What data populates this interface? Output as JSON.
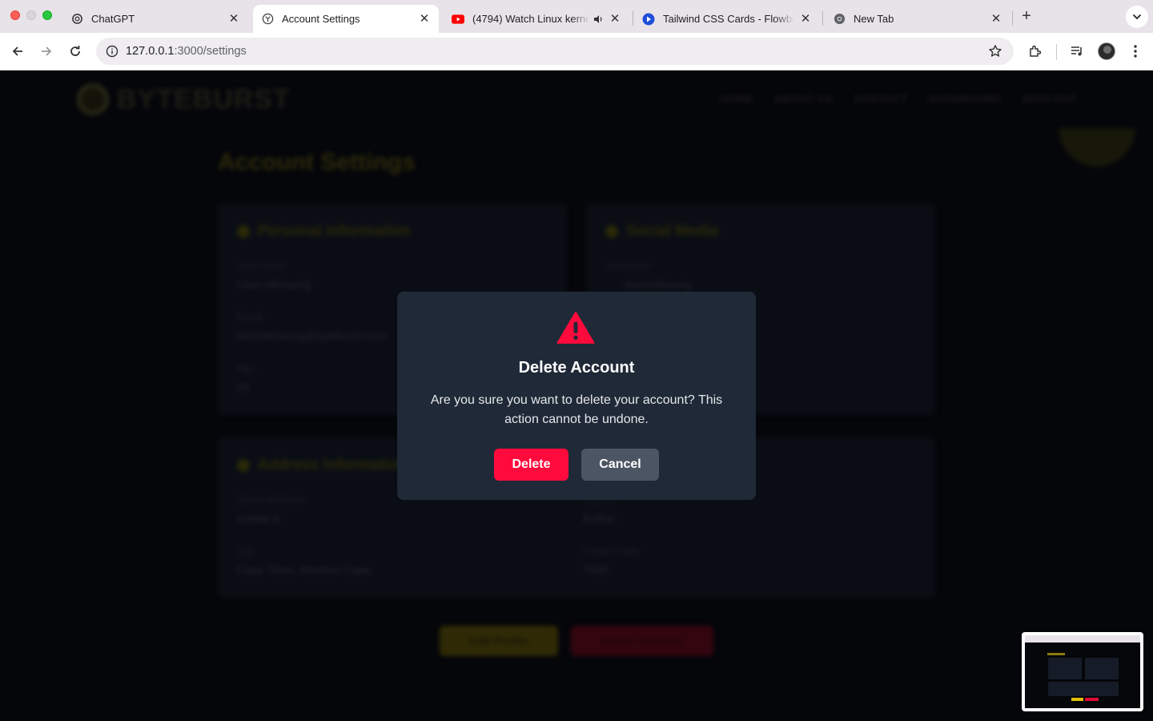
{
  "browser": {
    "tabs": [
      {
        "title": "ChatGPT",
        "icon": "chatgpt-icon"
      },
      {
        "title": "Account Settings",
        "icon": "globe-icon",
        "active": true
      },
      {
        "title": "(4794) Watch Linux kerne",
        "icon": "youtube-icon",
        "audio": true
      },
      {
        "title": "Tailwind CSS Cards - Flowbite",
        "icon": "flowbite-icon"
      },
      {
        "title": "New Tab",
        "icon": "chrome-icon"
      }
    ],
    "url_host": "127.0.0.1",
    "url_path": ":3000/settings"
  },
  "site": {
    "brand": "BYTEBURST",
    "nav": [
      "HOME",
      "ABOUT US",
      "CONTACT",
      "DASHBOARD",
      "SIGN OUT"
    ],
    "page_title": "Account Settings",
    "cards": {
      "personal": {
        "heading": "Personal Information",
        "fields": [
          {
            "label": "Username",
            "value": "Liam Mkhaung"
          },
          {
            "label": "Email",
            "value": "liammkhaung@byteburst.com"
          },
          {
            "label": "Age",
            "value": "24"
          }
        ]
      },
      "social": {
        "heading": "Social Media",
        "fields": [
          {
            "label": "Instagram",
            "value": "liammkhaung"
          }
        ]
      },
      "address": {
        "heading": "Address Information",
        "fields": [
          {
            "label": "Street Address",
            "value": "Amber 6"
          },
          {
            "label": "City",
            "value": "Cape Town, Western Cape"
          },
          {
            "label": "Suburb",
            "value": "Bothar"
          },
          {
            "label": "Postal Code",
            "value": "7405"
          }
        ]
      }
    },
    "edit_button": "Edit Profile",
    "delete_button": "Delete Account"
  },
  "modal": {
    "icon": "warning-triangle-icon",
    "title": "Delete Account",
    "message": "Are you sure you want to delete your account? This action cannot be undone.",
    "confirm_label": "Delete",
    "cancel_label": "Cancel",
    "colors": {
      "background": "#1f2937",
      "danger": "#ff0a3c",
      "neutral": "#4b5563"
    }
  }
}
